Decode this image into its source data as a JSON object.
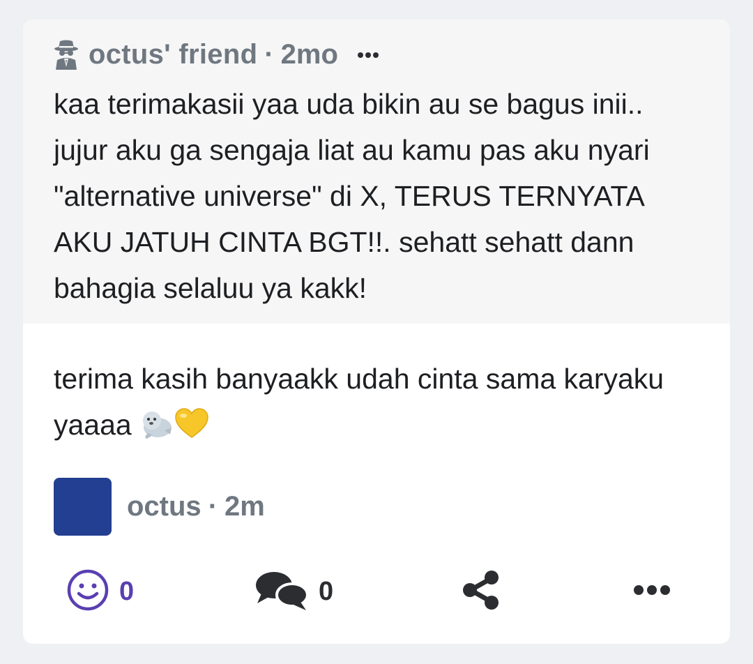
{
  "question": {
    "author": "octus' friend",
    "separator": "·",
    "time": "2mo",
    "icon": "anonymous-spy-icon",
    "text": "kaa terimakasii yaa uda bikin au se bagus inii.. jujur aku ga sengaja liat au kamu pas aku nyari \"alternative universe\" di X, TERUS TERNYATA AKU JATUH CINTA BGT!!. sehatt sehatt dann bahagia selaluu ya kakk!"
  },
  "answer": {
    "text": "terima kasih banyaakk udah cinta sama karyaku yaaaa",
    "emojis": [
      "seal-emoji",
      "yellow-heart-emoji"
    ],
    "author": "octus",
    "separator": "·",
    "time": "2m",
    "avatar_color": "#233f91"
  },
  "actions": {
    "reactions_count": "0",
    "comments_count": "0",
    "react_icon": "smiley-icon",
    "comment_icon": "comments-icon",
    "share_icon": "share-icon",
    "more_icon": "more-dots-icon",
    "accent_color": "#5a3fb0"
  }
}
